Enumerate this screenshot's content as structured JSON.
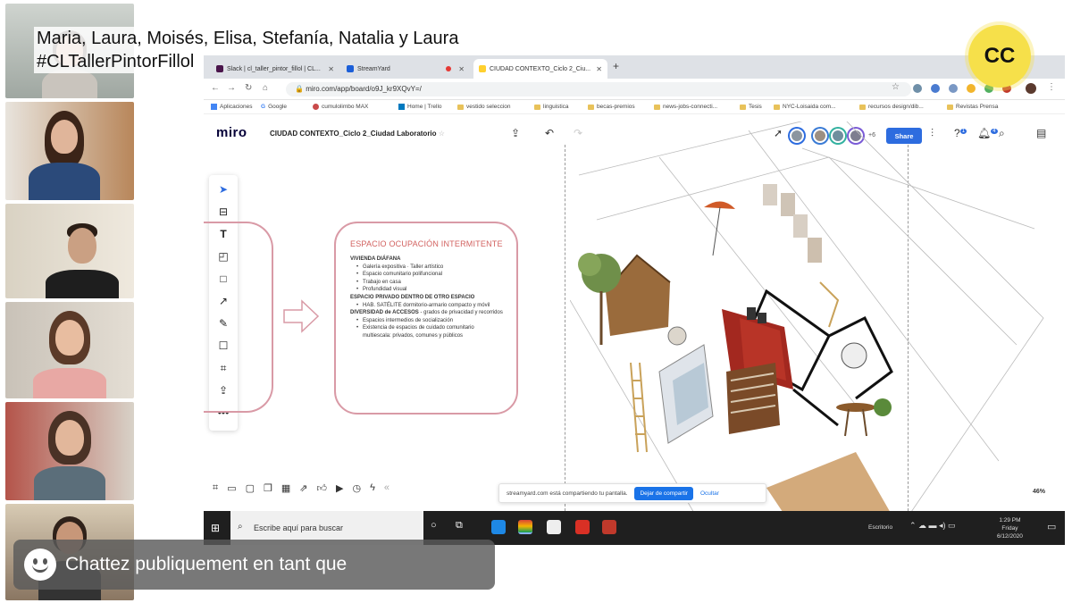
{
  "overlay": {
    "names": "Maria, Laura, Moisés, Elisa, Stefanía, Natalia y Laura",
    "hashtag": "#CLTallerPintorFillol",
    "badge": "CC"
  },
  "browser": {
    "tabs": [
      {
        "label": "Slack | cl_taller_pintor_fillol | CL...",
        "active": false
      },
      {
        "label": "StreamYard",
        "active": false
      },
      {
        "label": "CIUDAD CONTEXTO_Ciclo 2_Ciu...",
        "active": true
      }
    ],
    "url": "miro.com/app/board/o9J_kr9XQvY=/",
    "bookmarks": [
      "Aplicaciones",
      "Google",
      "cumulolimbo MAX",
      "Home | Trello",
      "vestido seleccion",
      "linguistica",
      "becas-premios",
      "news-jobs-connecti...",
      "Tesis",
      "NYC-Loisaida com...",
      "recursos design/dib...",
      "Revistas Prensa"
    ]
  },
  "miro": {
    "logo": "miro",
    "board_title": "CIUDAD CONTEXTO_Ciclo 2_Ciudad Laboratorio",
    "share_label": "Share",
    "collab_count": "+6",
    "zoom": "46%",
    "notifications": {
      "help": "1",
      "bell": "4"
    },
    "card": {
      "title": "ESPACIO OCUPACIÓN INTERMITENTE",
      "sections": [
        {
          "heading": "VIVIENDA DIÁFANA",
          "heading_rest": "",
          "items": [
            "Galería expositiva · Taller artístico",
            "Espacio comunitario polifuncional",
            "Trabajo en casa",
            "Profundidad visual"
          ]
        },
        {
          "heading": "ESPACIO PRIVADO DENTRO DE OTRO ESPACIO",
          "heading_rest": "",
          "items": [
            "HAB. SATÉLITE dormitorio-armario compacto y móvil"
          ]
        },
        {
          "heading": "DIVERSIDAD de ACCESOS",
          "heading_rest": " - grados de privacidad y recorridos",
          "items": [
            "Espacios intermedios de socialización",
            "Existencia de espacios de cuidado comunitario multiescala: privados, comunes y públicos"
          ]
        }
      ]
    }
  },
  "share_notice": {
    "text": "streamyard.com está compartiendo tu pantalla.",
    "stop": "Dejar de compartir",
    "hide": "Ocultar"
  },
  "taskbar": {
    "search_placeholder": "Escribe aquí para buscar",
    "desktop_label": "Escritorio",
    "time": "1:29 PM",
    "day": "Friday",
    "date": "6/12/2020"
  },
  "chat": {
    "placeholder": "Chattez publiquement en tant que"
  },
  "colors": {
    "card_border": "#d99aa6",
    "card_title": "#d2615f",
    "share_blue": "#2d6cdf",
    "badge_yellow": "#f6e04a",
    "chat_bg": "#5a5a5a"
  }
}
